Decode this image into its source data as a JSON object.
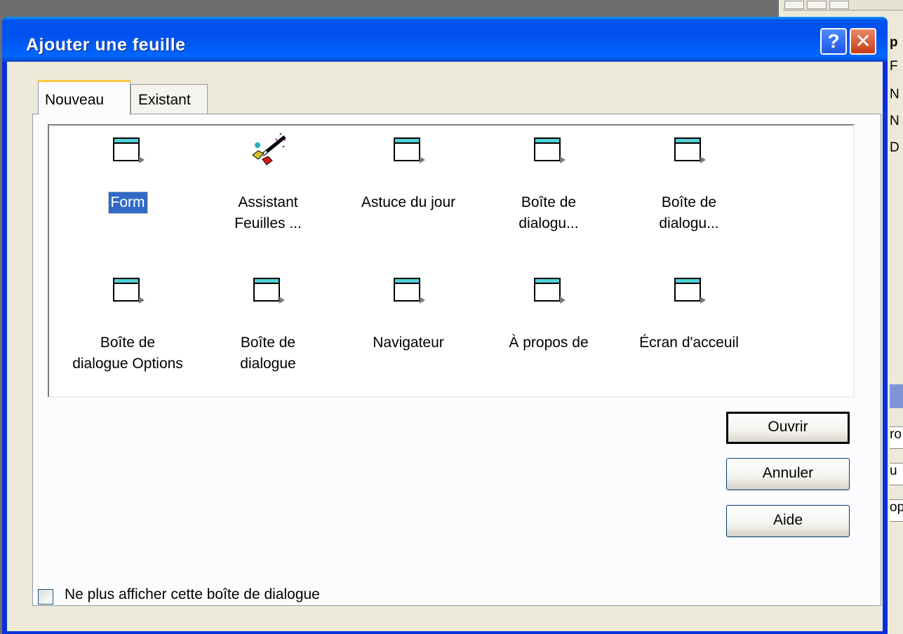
{
  "background": {
    "right_texts": [
      "p",
      "F",
      "N",
      "N",
      "D"
    ],
    "inputs": [
      "ro",
      "u",
      "op"
    ]
  },
  "dialog": {
    "title": "Ajouter une feuille",
    "help_label": "?",
    "close_label": "✕",
    "tabs": [
      {
        "label": "Nouveau",
        "selected": true
      },
      {
        "label": "Existant",
        "selected": false
      }
    ],
    "items": [
      {
        "label": "Form",
        "icon": "form-icon",
        "selected": true
      },
      {
        "label": "Assistant\nFeuilles ...",
        "icon": "wizard-icon",
        "selected": false
      },
      {
        "label": "Astuce du jour",
        "icon": "form-icon",
        "selected": false
      },
      {
        "label": "Boîte de\ndialogu...",
        "icon": "form-icon",
        "selected": false
      },
      {
        "label": "Boîte de\ndialogu...",
        "icon": "form-icon",
        "selected": false
      },
      {
        "label": "Boîte de\ndialogue Options",
        "icon": "form-icon",
        "selected": false
      },
      {
        "label": "Boîte de\ndialogue",
        "icon": "form-icon",
        "selected": false
      },
      {
        "label": "Navigateur",
        "icon": "form-icon",
        "selected": false
      },
      {
        "label": "À propos de",
        "icon": "form-icon",
        "selected": false
      },
      {
        "label": "Écran d'acceuil",
        "icon": "form-icon",
        "selected": false
      }
    ],
    "buttons": {
      "open": "Ouvrir",
      "cancel": "Annuler",
      "help": "Aide"
    },
    "checkbox": {
      "label": "Ne plus afficher cette boîte de dialogue",
      "checked": false
    }
  }
}
